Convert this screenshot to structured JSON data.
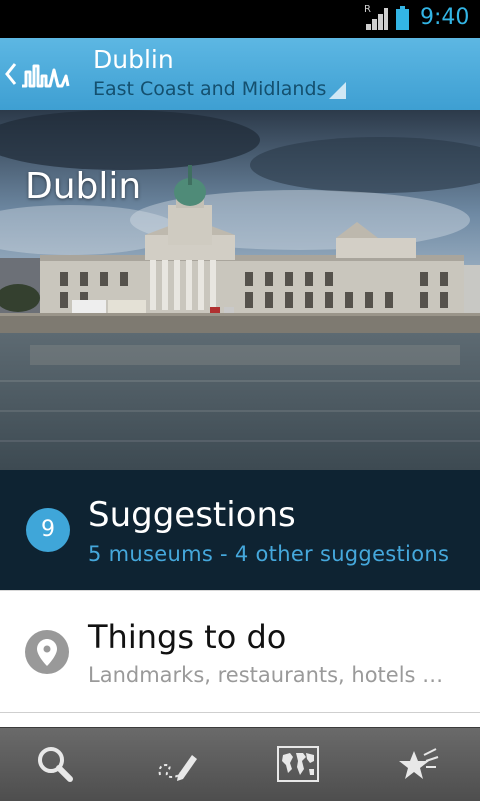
{
  "status_bar": {
    "time": "9:40",
    "signal_label": "R",
    "icons": [
      "signal-icon",
      "battery-icon"
    ]
  },
  "action_bar": {
    "title": "Dublin",
    "subtitle": "East Coast and Midlands",
    "icons": [
      "up-arrow-icon",
      "app-logo-icon",
      "spinner-arrow-icon"
    ]
  },
  "hero": {
    "title": "Dublin"
  },
  "suggestions": {
    "count": "9",
    "title": "Suggestions",
    "subtitle": "5 museums - 4 other suggestions"
  },
  "things_to_do": {
    "title": "Things to do",
    "subtitle": "Landmarks, restaurants, hotels …",
    "icon": "map-pin-icon"
  },
  "bottom_bar": {
    "tabs": [
      "search-icon",
      "draw-icon",
      "world-map-icon",
      "favorites-icon"
    ]
  },
  "colors": {
    "accent": "#33b5e5",
    "action_bar": "#4aa9da",
    "suggestions_bg": "#0e2332",
    "badge": "#3fa6d9"
  }
}
